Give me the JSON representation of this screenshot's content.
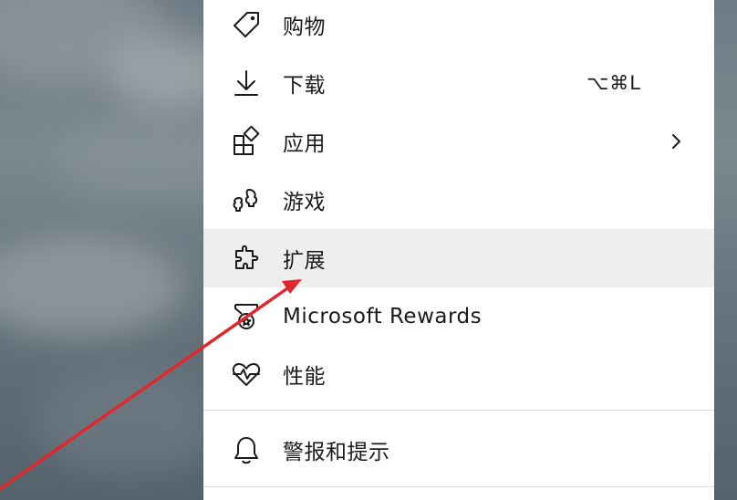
{
  "menu": {
    "items": [
      {
        "label": "购物",
        "icon": "tag-icon"
      },
      {
        "label": "下载",
        "icon": "download-icon",
        "shortcut": "⌥⌘L"
      },
      {
        "label": "应用",
        "icon": "apps-icon",
        "has_submenu": true
      },
      {
        "label": "游戏",
        "icon": "game-icon"
      },
      {
        "label": "扩展",
        "icon": "puzzle-icon",
        "highlighted": true
      },
      {
        "label": "Microsoft Rewards",
        "icon": "medal-icon"
      },
      {
        "label": "性能",
        "icon": "heartbeat-icon"
      },
      {
        "label": "警报和提示",
        "icon": "bell-icon"
      }
    ]
  },
  "annotation": {
    "color": "#e0282c"
  },
  "colors": {
    "menu_background": "#ffffff",
    "highlight_background": "#eeeeee",
    "text": "#1b1b1b"
  }
}
